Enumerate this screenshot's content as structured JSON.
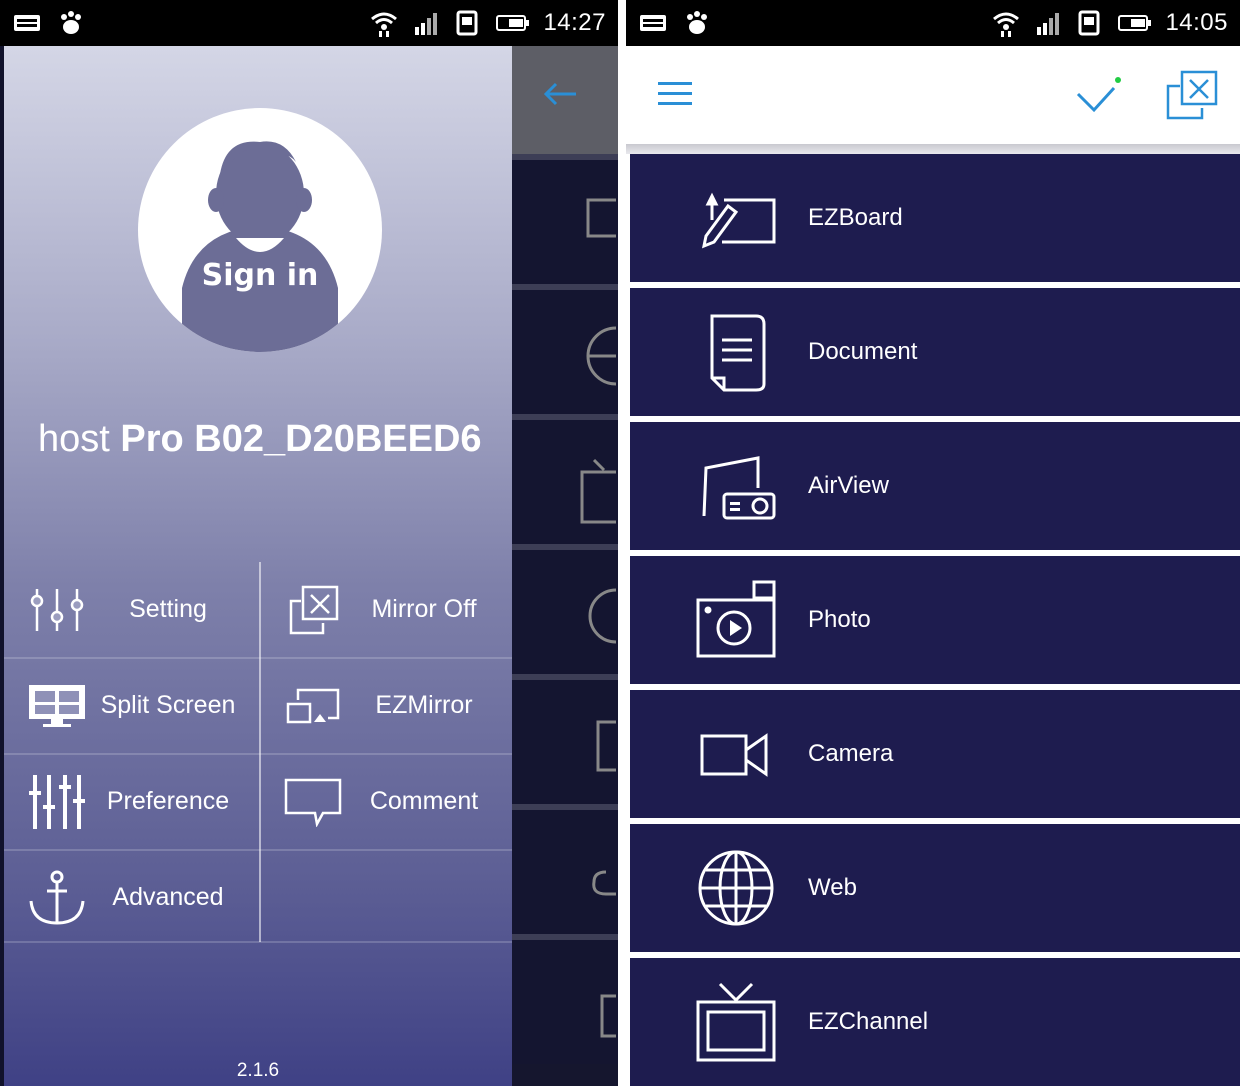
{
  "left": {
    "status_time": "14:27",
    "avatar_label": "Sign in",
    "host_prefix": "host",
    "host_name": "Pro B02_D20BEED6",
    "menu": [
      {
        "label": "Setting",
        "icon": "sliders-icon"
      },
      {
        "label": "Mirror Off",
        "icon": "mirror-off-icon"
      },
      {
        "label": "Split Screen",
        "icon": "split-screen-icon"
      },
      {
        "label": "EZMirror",
        "icon": "ezmirror-icon"
      },
      {
        "label": "Preference",
        "icon": "equalizer-icon"
      },
      {
        "label": "Comment",
        "icon": "comment-icon"
      },
      {
        "label": "Advanced",
        "icon": "anchor-icon"
      }
    ],
    "version": "2.1.6"
  },
  "right": {
    "status_time": "14:05",
    "features": [
      {
        "label": "EZBoard",
        "icon": "whiteboard-pencil-icon"
      },
      {
        "label": "Document",
        "icon": "document-icon"
      },
      {
        "label": "AirView",
        "icon": "projector-icon"
      },
      {
        "label": "Photo",
        "icon": "photo-icon"
      },
      {
        "label": "Camera",
        "icon": "video-camera-icon"
      },
      {
        "label": "Web",
        "icon": "globe-icon"
      },
      {
        "label": "EZChannel",
        "icon": "tv-icon"
      }
    ]
  },
  "colors": {
    "feature_bg": "#1e1c4f",
    "accent_blue": "#2a8fd6",
    "status_bar": "#000000"
  }
}
